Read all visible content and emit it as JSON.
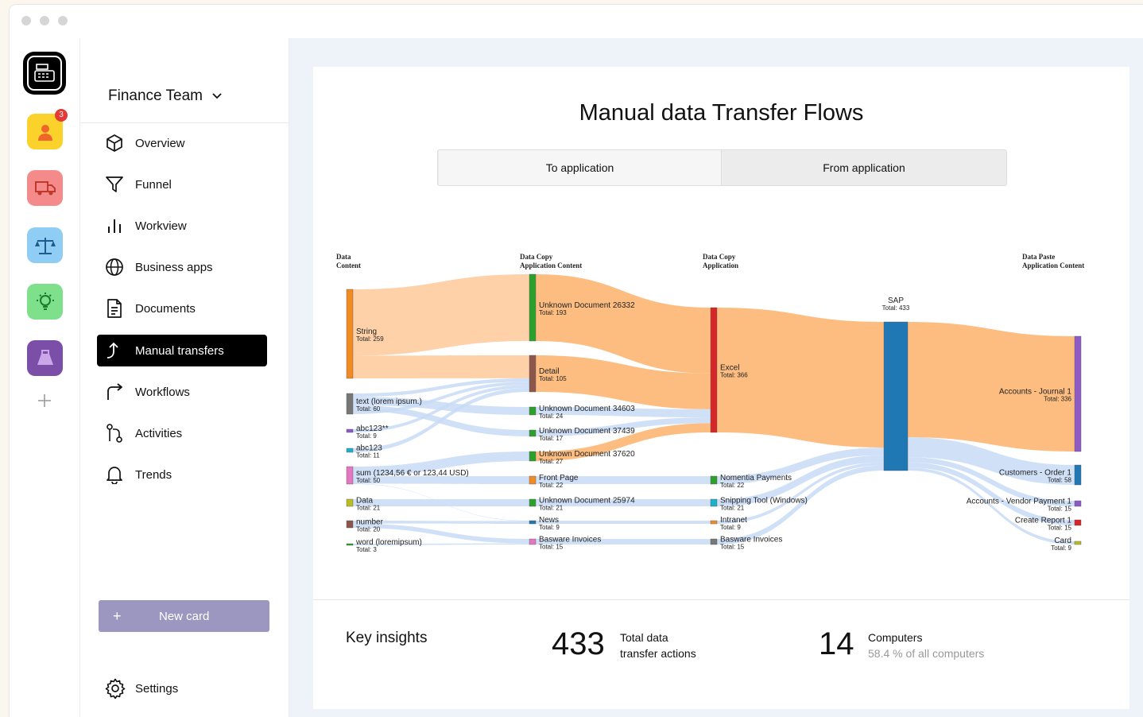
{
  "window": {
    "controls": [
      "close",
      "minimize",
      "maximize"
    ]
  },
  "rail": {
    "apps": [
      {
        "name": "app-person",
        "color": "#fbd22b",
        "badge": "3"
      },
      {
        "name": "app-truck",
        "color": "#f48a8a"
      },
      {
        "name": "app-scale",
        "color": "#8fcdf5"
      },
      {
        "name": "app-bulb",
        "color": "#7ee08a"
      },
      {
        "name": "app-lab",
        "color": "#7b4fa8"
      }
    ]
  },
  "nav": {
    "team": "Finance Team",
    "items": [
      {
        "label": "Overview",
        "icon": "cube-icon"
      },
      {
        "label": "Funnel",
        "icon": "funnel-icon"
      },
      {
        "label": "Workview",
        "icon": "bar-chart-icon"
      },
      {
        "label": "Business apps",
        "icon": "globe-icon"
      },
      {
        "label": "Documents",
        "icon": "document-icon"
      },
      {
        "label": "Manual transfers",
        "icon": "transfer-icon",
        "active": true
      },
      {
        "label": "Workflows",
        "icon": "redo-arrow-icon"
      },
      {
        "label": "Activities",
        "icon": "activities-icon"
      },
      {
        "label": "Trends",
        "icon": "bell-icon"
      }
    ],
    "new_card": "New card",
    "new_card_plus": "+",
    "settings": "Settings"
  },
  "main": {
    "title": "Manual data Transfer Flows",
    "toggle": {
      "selected": "To application",
      "other": "From application"
    }
  },
  "chart_data": {
    "type": "sankey",
    "columns": [
      {
        "header": [
          "Data",
          "Content"
        ]
      },
      {
        "header": [
          "Data Copy",
          "Application Content"
        ]
      },
      {
        "header": [
          "Data Copy",
          "Application"
        ]
      },
      {
        "header": [
          "Data Paste",
          "Application Content"
        ]
      }
    ],
    "nodes": [
      {
        "label": "String",
        "total": "Total: 259",
        "color": "#f28b22"
      },
      {
        "label": "text (lorem ipsum.)",
        "total": "Total: 60",
        "color": "#777777"
      },
      {
        "label": "abc123**",
        "total": "Total: 9",
        "color": "#8e5bc4"
      },
      {
        "label": "abc123",
        "total": "Total: 11",
        "color": "#1fb0c9"
      },
      {
        "label": "sum (1234,56 € or 123,44 USD)",
        "total": "Total: 50",
        "color": "#e377c2"
      },
      {
        "label": "Data",
        "total": "Total: 21",
        "color": "#bcbd22"
      },
      {
        "label": "number",
        "total": "Total: 20",
        "color": "#8c564b"
      },
      {
        "label": "word (loremipsum)",
        "total": "Total: 3",
        "color": "#2ca02c"
      },
      {
        "label": "Unknown Document 26332",
        "total": "Total: 193",
        "color": "#2ca02c"
      },
      {
        "label": "Detail",
        "total": "Total: 105",
        "color": "#8c564b"
      },
      {
        "label": "Unknown Document 34603",
        "total": "Total: 24",
        "color": "#2ca02c"
      },
      {
        "label": "Unknown Document 37439",
        "total": "Total: 17",
        "color": "#2ca02c"
      },
      {
        "label": "Unknown Document 37620",
        "total": "Total: 27",
        "color": "#2ca02c"
      },
      {
        "label": "Front Page",
        "total": "Total: 22",
        "color": "#f28b22"
      },
      {
        "label": "Unknown Document 25974",
        "total": "Total: 21",
        "color": "#2ca02c"
      },
      {
        "label": "News",
        "total": "Total: 9",
        "color": "#1f77b4"
      },
      {
        "label": "Basware Invoices",
        "total": "Total: 15",
        "color": "#e377c2"
      },
      {
        "label": "Excel",
        "total": "Total: 366",
        "color": "#d62728"
      },
      {
        "label": "Nomentia Payments",
        "total": "Total: 22",
        "color": "#2ca02c"
      },
      {
        "label": "Snipping Tool (Windows)",
        "total": "Total: 21",
        "color": "#1fb0c9"
      },
      {
        "label": "Intranet",
        "total": "Total: 9",
        "color": "#f28b22"
      },
      {
        "label": "Basware Invoices",
        "total": "Total: 15",
        "color": "#777777"
      },
      {
        "label": "SAP",
        "total": "Total: 433",
        "color": "#1f77b4"
      },
      {
        "label": "Accounts - Journal 1",
        "total": "Total: 336",
        "color": "#8e5bc4"
      },
      {
        "label": "Customers - Order 1",
        "total": "Total: 58",
        "color": "#1f77b4"
      },
      {
        "label": "Accounts - Vendor Payment 1",
        "total": "Total: 15",
        "color": "#8e5bc4"
      },
      {
        "label": "Create Report 1",
        "total": "Total: 15",
        "color": "#d62728"
      },
      {
        "label": "Card",
        "total": "Total: 9",
        "color": "#bcbd22"
      }
    ],
    "links": [
      {
        "source": 0,
        "target": 8,
        "value": 193
      },
      {
        "source": 0,
        "target": 9,
        "value": 66
      },
      {
        "source": 1,
        "target": 9,
        "value": 10
      },
      {
        "source": 1,
        "target": 10,
        "value": 24
      },
      {
        "source": 1,
        "target": 11,
        "value": 17
      },
      {
        "source": 1,
        "target": 9,
        "value": 9
      },
      {
        "source": 2,
        "target": 9,
        "value": 9
      },
      {
        "source": 3,
        "target": 9,
        "value": 11
      },
      {
        "source": 4,
        "target": 12,
        "value": 27
      },
      {
        "source": 4,
        "target": 13,
        "value": 22
      },
      {
        "source": 4,
        "target": 15,
        "value": 1
      },
      {
        "source": 5,
        "target": 14,
        "value": 21
      },
      {
        "source": 6,
        "target": 15,
        "value": 8
      },
      {
        "source": 6,
        "target": 16,
        "value": 12
      },
      {
        "source": 7,
        "target": 16,
        "value": 3
      },
      {
        "source": 8,
        "target": 17,
        "value": 193
      },
      {
        "source": 9,
        "target": 17,
        "value": 105
      },
      {
        "source": 10,
        "target": 17,
        "value": 24
      },
      {
        "source": 11,
        "target": 17,
        "value": 17
      },
      {
        "source": 12,
        "target": 17,
        "value": 27
      },
      {
        "source": 13,
        "target": 18,
        "value": 22
      },
      {
        "source": 14,
        "target": 19,
        "value": 21
      },
      {
        "source": 15,
        "target": 20,
        "value": 9
      },
      {
        "source": 16,
        "target": 21,
        "value": 15
      },
      {
        "source": 17,
        "target": 22,
        "value": 366
      },
      {
        "source": 18,
        "target": 22,
        "value": 22
      },
      {
        "source": 19,
        "target": 22,
        "value": 21
      },
      {
        "source": 20,
        "target": 22,
        "value": 9
      },
      {
        "source": 21,
        "target": 22,
        "value": 15
      },
      {
        "source": 22,
        "target": 23,
        "value": 336
      },
      {
        "source": 22,
        "target": 24,
        "value": 58
      },
      {
        "source": 22,
        "target": 25,
        "value": 15
      },
      {
        "source": 22,
        "target": 26,
        "value": 15
      },
      {
        "source": 22,
        "target": 27,
        "value": 9
      }
    ]
  },
  "insights": {
    "label": "Key insights",
    "total_value": "433",
    "total_line1": "Total data",
    "total_line2": "transfer actions",
    "computers_value": "14",
    "computers_label": "Computers",
    "computers_sub": "58.4 % of all computers"
  }
}
